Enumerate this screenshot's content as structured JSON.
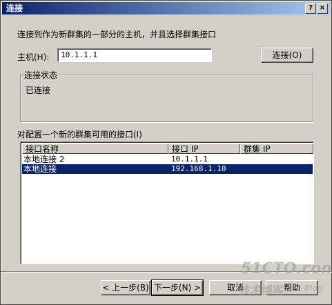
{
  "window": {
    "title": "连接",
    "help_btn": "?",
    "close_btn": "×"
  },
  "intro": "连接到作为新群集的一部分的主机，并且选择群集接口",
  "host": {
    "label": "主机(H):",
    "value": "10.1.1.1",
    "connect_button": "连接(O)"
  },
  "status": {
    "group_label": "连接状态",
    "text": "已连接"
  },
  "interfaces": {
    "label": "对配置一个新的群集可用的接口(I)",
    "columns": [
      "接口名称",
      "接口 IP",
      "群集 IP"
    ],
    "rows": [
      {
        "name": "本地连接 2",
        "ip": "10.1.1.1",
        "cluster_ip": ""
      },
      {
        "name": "本地连接",
        "ip": "192.168.1.10",
        "cluster_ip": ""
      }
    ],
    "selected_index": 1
  },
  "buttons": {
    "back": "< 上一步(B)",
    "next": "下一步(N) >",
    "cancel": "取消",
    "help": "帮助"
  },
  "watermark": {
    "site": "51CTO.com",
    "tagline": "技术博客",
    "blog": "Blog"
  }
}
